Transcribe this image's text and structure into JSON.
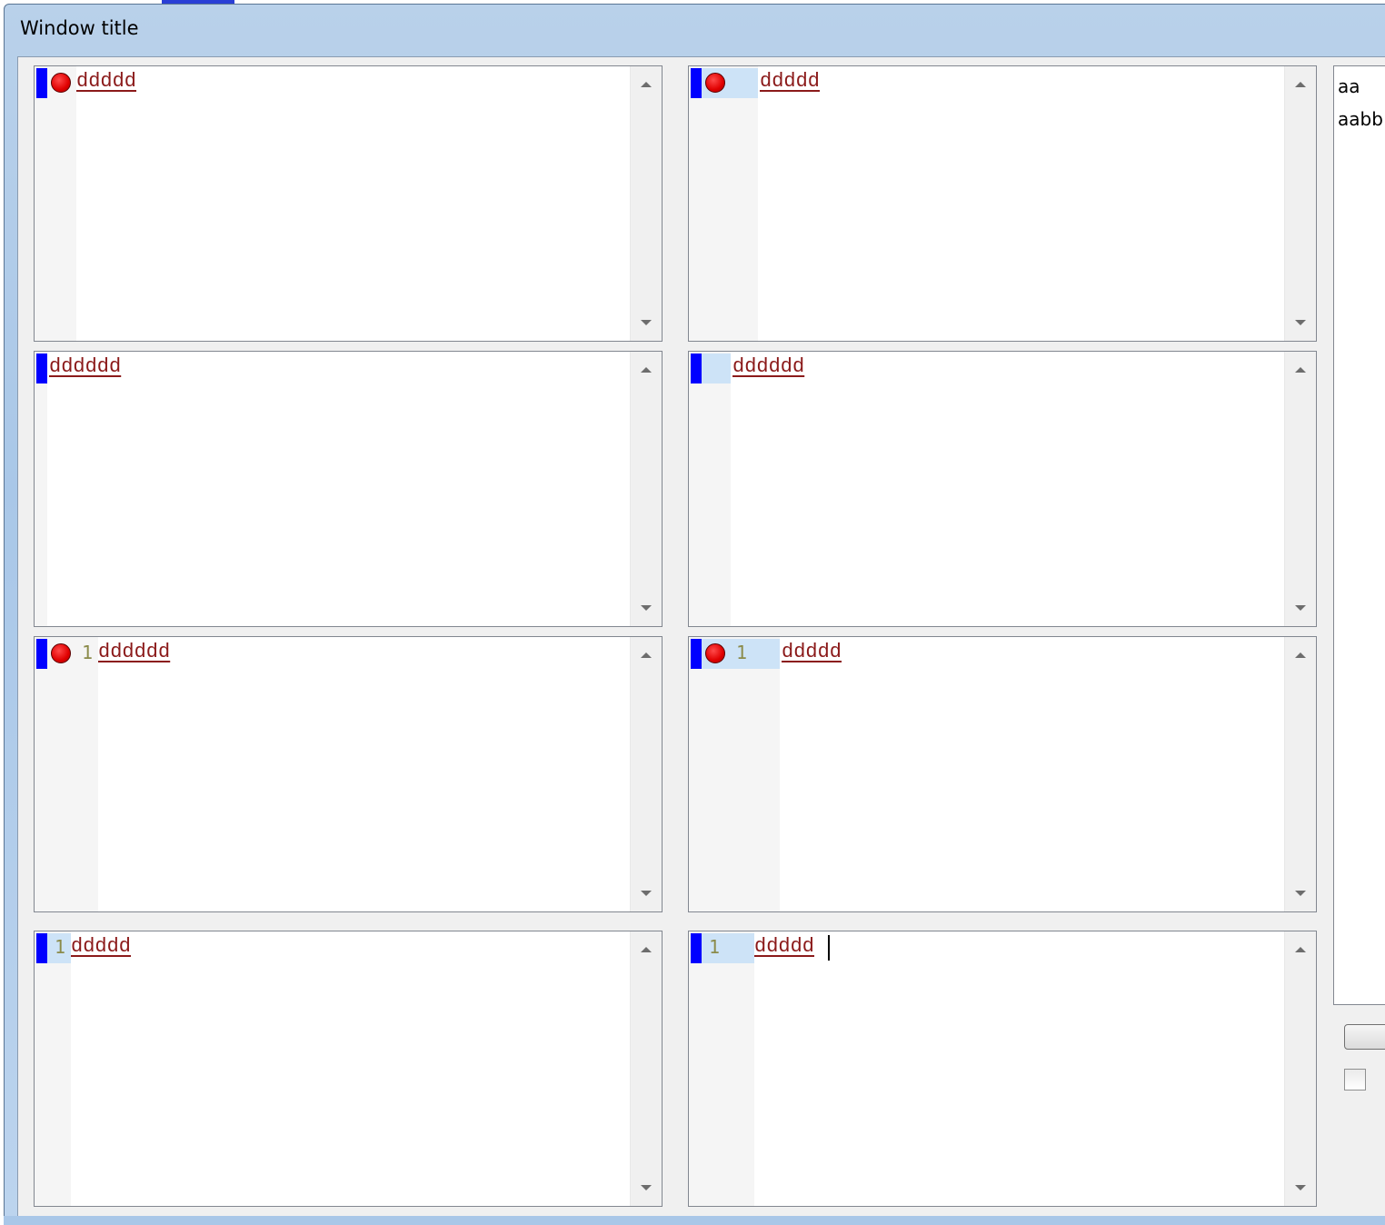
{
  "window": {
    "title": "Window title"
  },
  "editors": [
    {
      "id": "e1",
      "marker": true,
      "breakpoint": true,
      "line_number": "",
      "text": "ddddd",
      "caret": false
    },
    {
      "id": "e2",
      "marker": true,
      "breakpoint": true,
      "line_number": "",
      "text": "ddddd",
      "caret": false
    },
    {
      "id": "e3",
      "marker": true,
      "breakpoint": false,
      "line_number": "",
      "text": "dddddd",
      "caret": false
    },
    {
      "id": "e4",
      "marker": true,
      "breakpoint": false,
      "line_number": "",
      "text": "dddddd",
      "caret": false
    },
    {
      "id": "e5",
      "marker": true,
      "breakpoint": true,
      "line_number": "1",
      "text": "dddddd",
      "caret": false
    },
    {
      "id": "e6",
      "marker": true,
      "breakpoint": true,
      "line_number": "1",
      "text": "ddddd",
      "caret": false
    },
    {
      "id": "e7",
      "marker": true,
      "breakpoint": false,
      "line_number": "1",
      "text": "ddddd",
      "caret": false
    },
    {
      "id": "e8",
      "marker": true,
      "breakpoint": false,
      "line_number": "1",
      "text": "ddddd",
      "caret": true
    }
  ],
  "list": {
    "items": [
      "aa",
      "aabb"
    ]
  },
  "button": {
    "label": ""
  },
  "checkbox": {
    "checked": false
  },
  "colors": {
    "marker": "#0000ff",
    "breakpoint": "#e00000",
    "code_text": "#8b1a1a",
    "line_number": "#8b8b4a",
    "line_highlight": "#cde3f7"
  }
}
